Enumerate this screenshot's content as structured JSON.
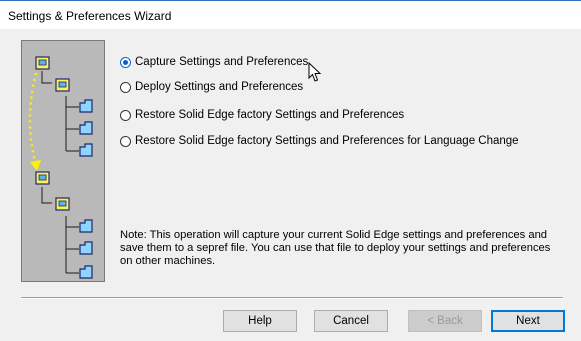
{
  "window": {
    "title": "Settings & Preferences Wizard"
  },
  "options": [
    {
      "label": "Capture Settings and Preferences",
      "selected": true
    },
    {
      "label": "Deploy Settings and Preferences",
      "selected": false
    },
    {
      "label": "Restore Solid Edge factory Settings and Preferences",
      "selected": false
    },
    {
      "label": "Restore Solid Edge factory Settings and Preferences for Language Change",
      "selected": false
    }
  ],
  "note": {
    "line1": "Note: This operation will capture your current Solid Edge settings and preferences and",
    "line2": "save them to a sepref file.  You can use that file to deploy your settings and preferences",
    "line3": "on other machines."
  },
  "buttons": {
    "help": "Help",
    "cancel": "Cancel",
    "back": "< Back",
    "next": "Next"
  },
  "colors": {
    "accent": "#0078d7",
    "folder": "#ffef5c",
    "sub_folder": "#8fd3ff",
    "arrow": "#fff200",
    "panel": "#b9b9b9"
  }
}
